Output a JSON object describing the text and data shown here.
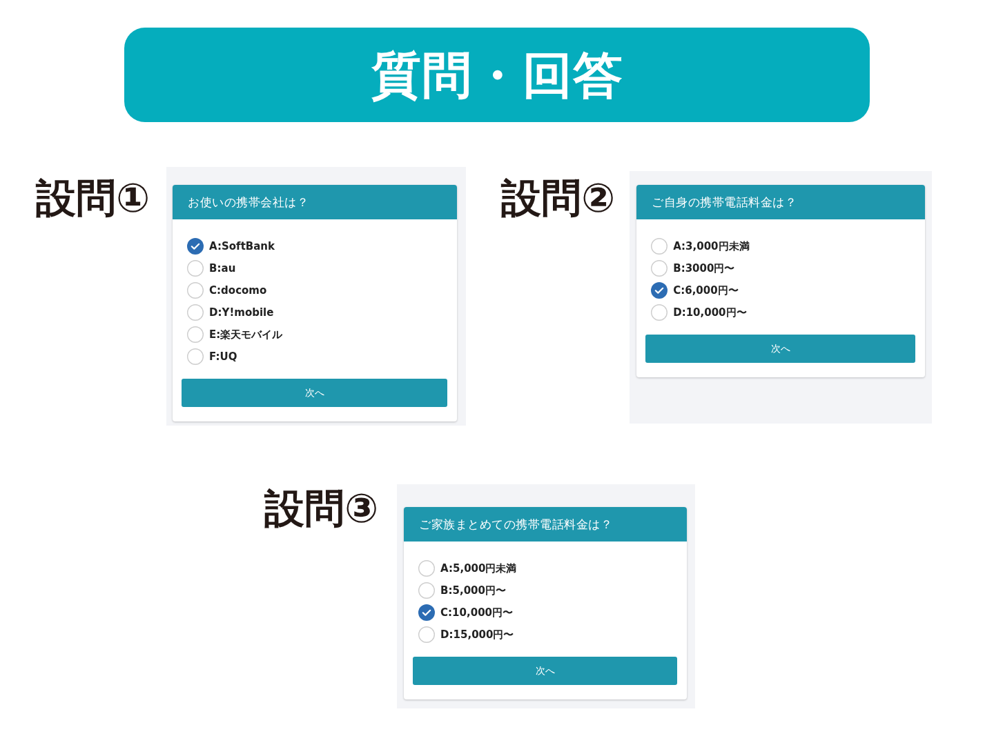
{
  "banner": {
    "title": "質問・回答"
  },
  "questions": [
    {
      "label": "設問①",
      "title": "お使いの携帯会社は？",
      "options": [
        {
          "label": "A:SoftBank",
          "selected": true
        },
        {
          "label": "B:au",
          "selected": false
        },
        {
          "label": "C:docomo",
          "selected": false
        },
        {
          "label": "D:Y!mobile",
          "selected": false
        },
        {
          "label": "E:楽天モバイル",
          "selected": false
        },
        {
          "label": "F:UQ",
          "selected": false
        }
      ],
      "button": "次へ"
    },
    {
      "label": "設問②",
      "title": "ご自身の携帯電話料金は？",
      "options": [
        {
          "label": "A:3,000円未満",
          "selected": false
        },
        {
          "label": "B:3000円〜",
          "selected": false
        },
        {
          "label": "C:6,000円〜",
          "selected": true
        },
        {
          "label": "D:10,000円〜",
          "selected": false
        }
      ],
      "button": "次へ"
    },
    {
      "label": "設問③",
      "title": "ご家族まとめての携帯電話料金は？",
      "options": [
        {
          "label": "A:5,000円未満",
          "selected": false
        },
        {
          "label": "B:5,000円〜",
          "selected": false
        },
        {
          "label": "C:10,000円〜",
          "selected": true
        },
        {
          "label": "D:15,000円〜",
          "selected": false
        }
      ],
      "button": "次へ"
    }
  ]
}
